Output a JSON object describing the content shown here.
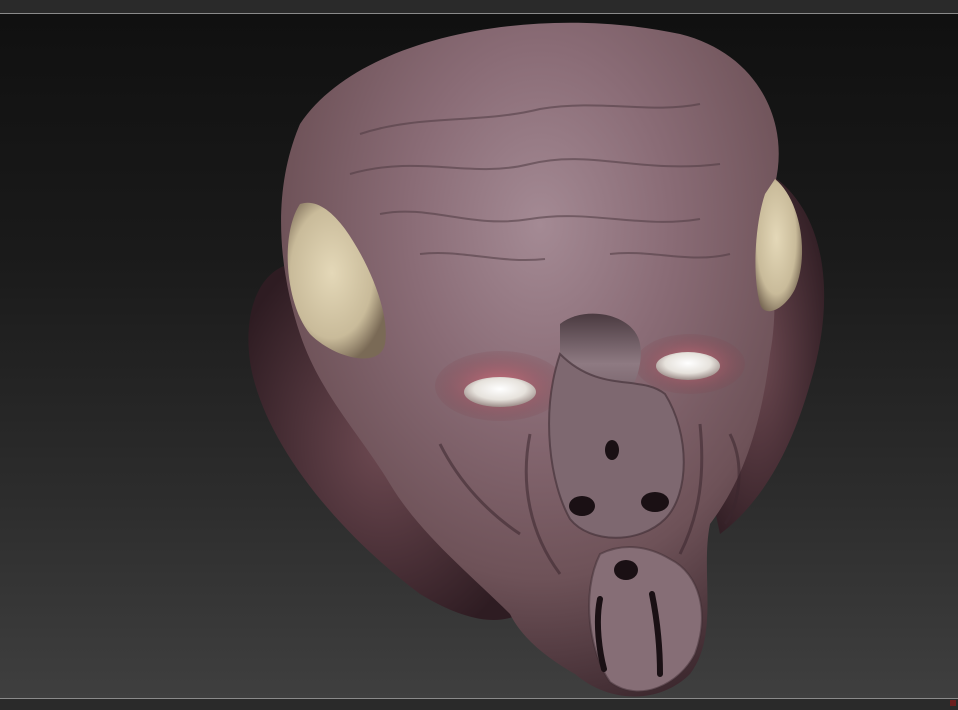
{
  "app": {
    "kind": "3d-sculpt-viewport"
  },
  "viewport": {
    "subject_icon": "alien-head-sculpt-icon",
    "background_colors": {
      "top": "#101010",
      "bottom": "#3f3f3f"
    },
    "skin_colors": {
      "base": "#6e5258",
      "highlight": "#a48a94",
      "shadow": "#2e1c22",
      "eye_rim": "#b65a6a",
      "eye": "#e6e2dc",
      "ear_fin": "#c9bb9a"
    }
  }
}
